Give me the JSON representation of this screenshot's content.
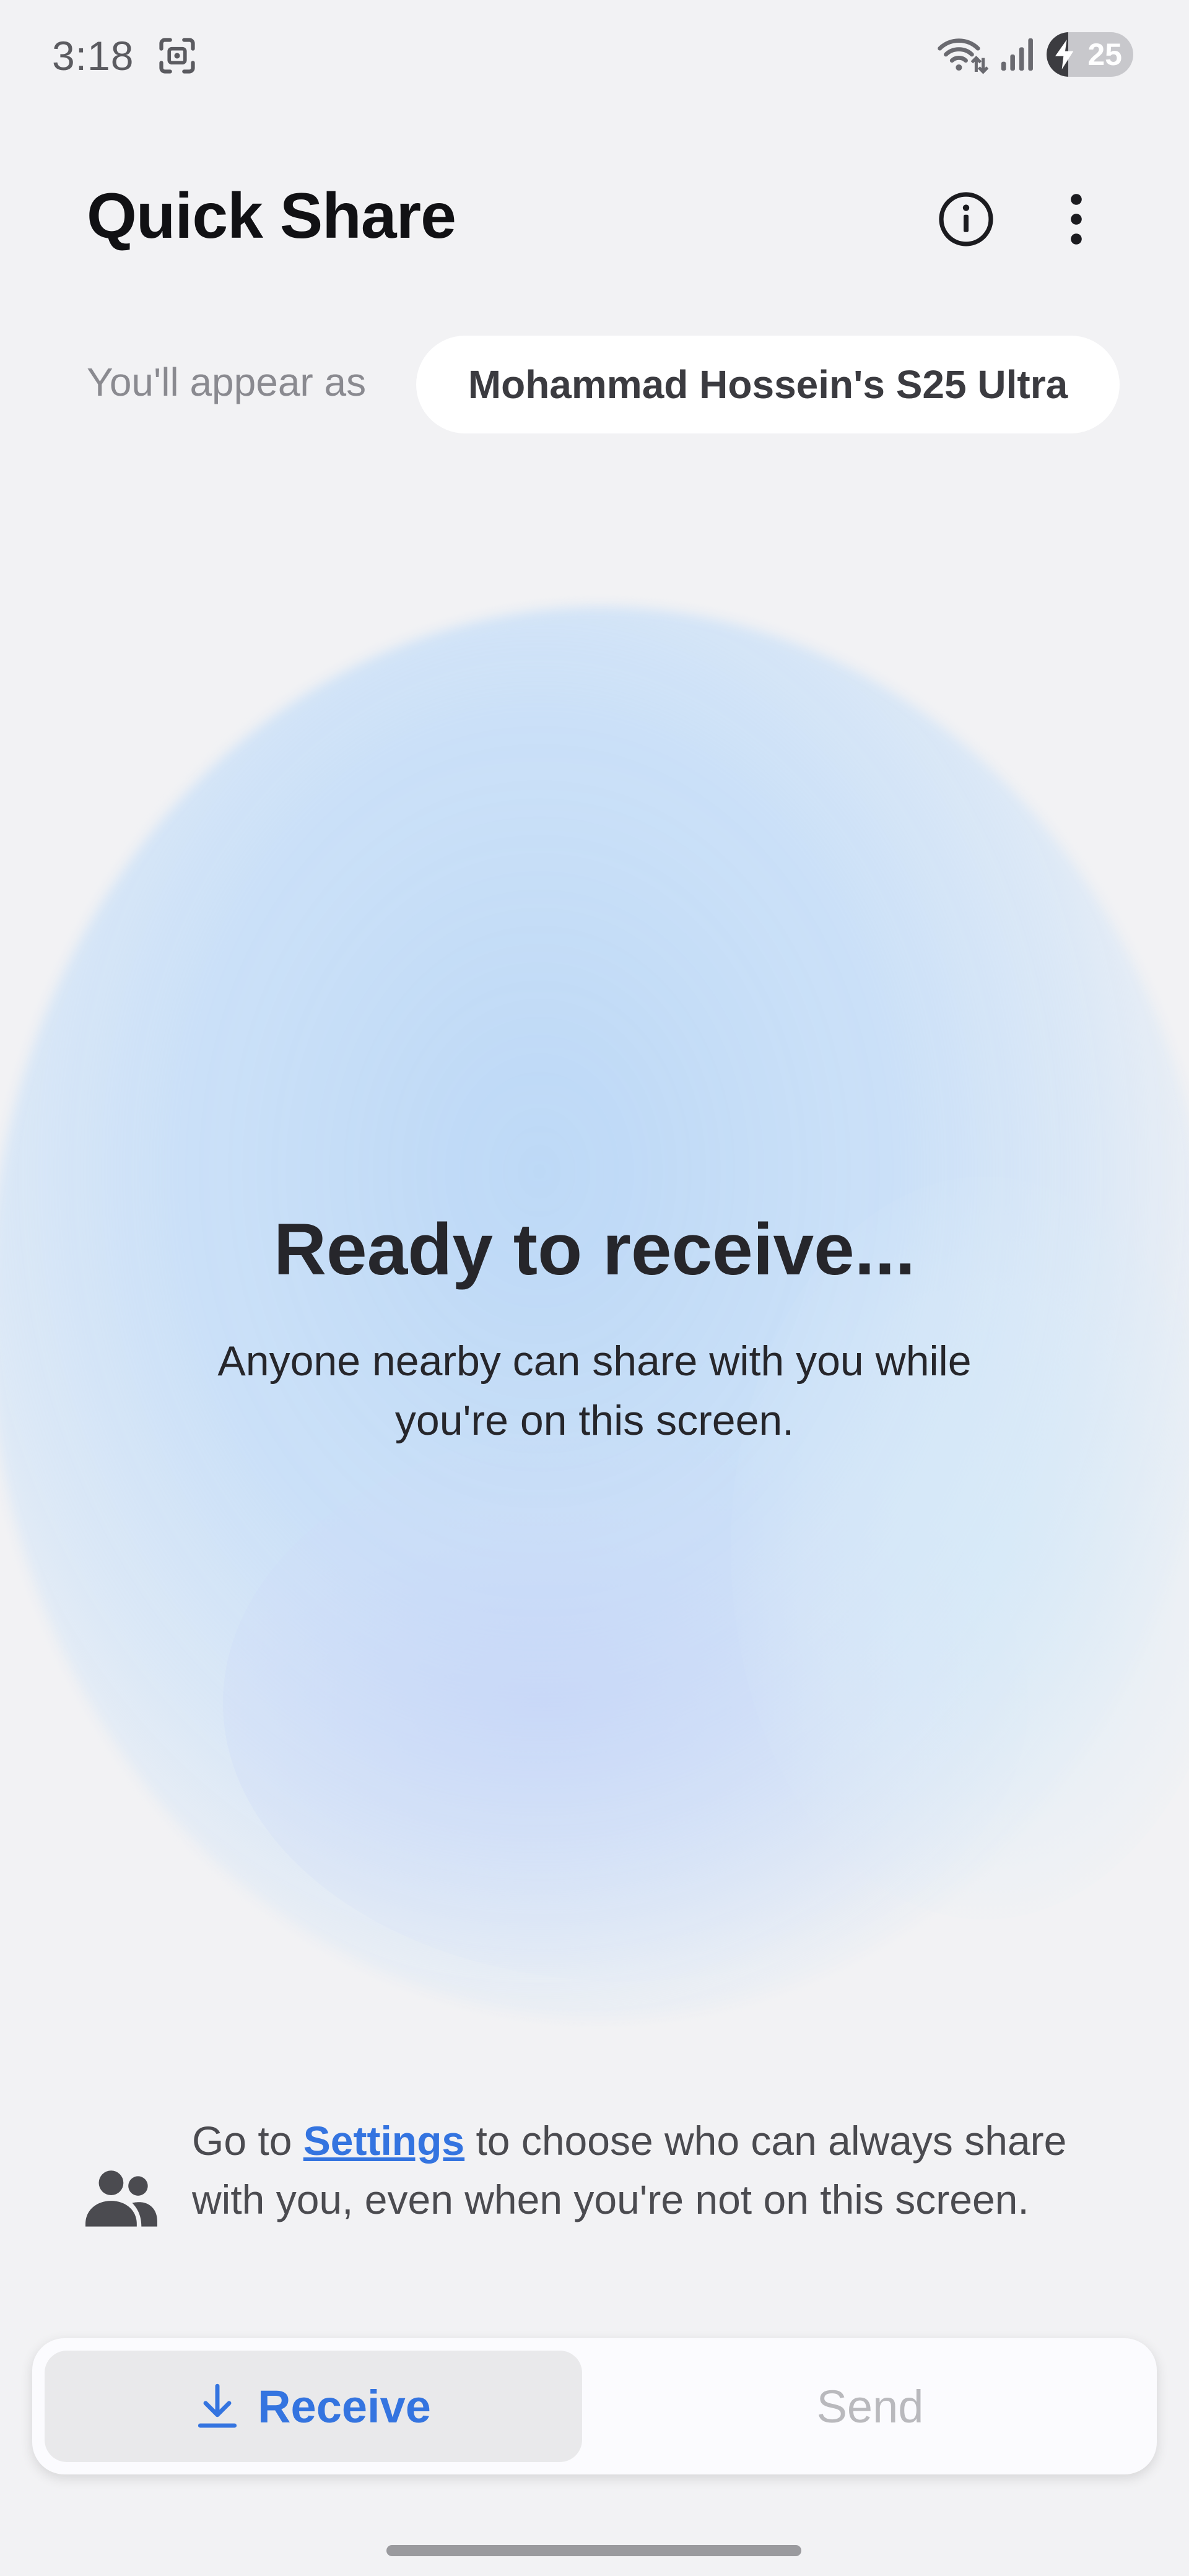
{
  "status_bar": {
    "time": "3:18",
    "battery_level": "25",
    "icons": [
      "screenshot-icon",
      "wifi-icon",
      "signal-icon",
      "battery-icon"
    ]
  },
  "header": {
    "title": "Quick Share",
    "info_icon": "info-icon",
    "more_icon": "more-vertical-icon"
  },
  "identity": {
    "label": "You'll appear as",
    "device_name": "Mohammad Hossein's S25 Ultra"
  },
  "main": {
    "title": "Ready to receive...",
    "subtitle": "Anyone nearby can share with you while you're on this screen."
  },
  "hint": {
    "icon": "people-icon",
    "prefix": "Go to ",
    "link": "Settings",
    "suffix": " to choose who can always share with you, even when you're not on this screen."
  },
  "tabs": {
    "receive_label": "Receive",
    "send_label": "Send",
    "selected": "Receive"
  },
  "colors": {
    "accent": "#3474e0",
    "background": "#f2f2f4",
    "glow": "#bcd8f6"
  }
}
